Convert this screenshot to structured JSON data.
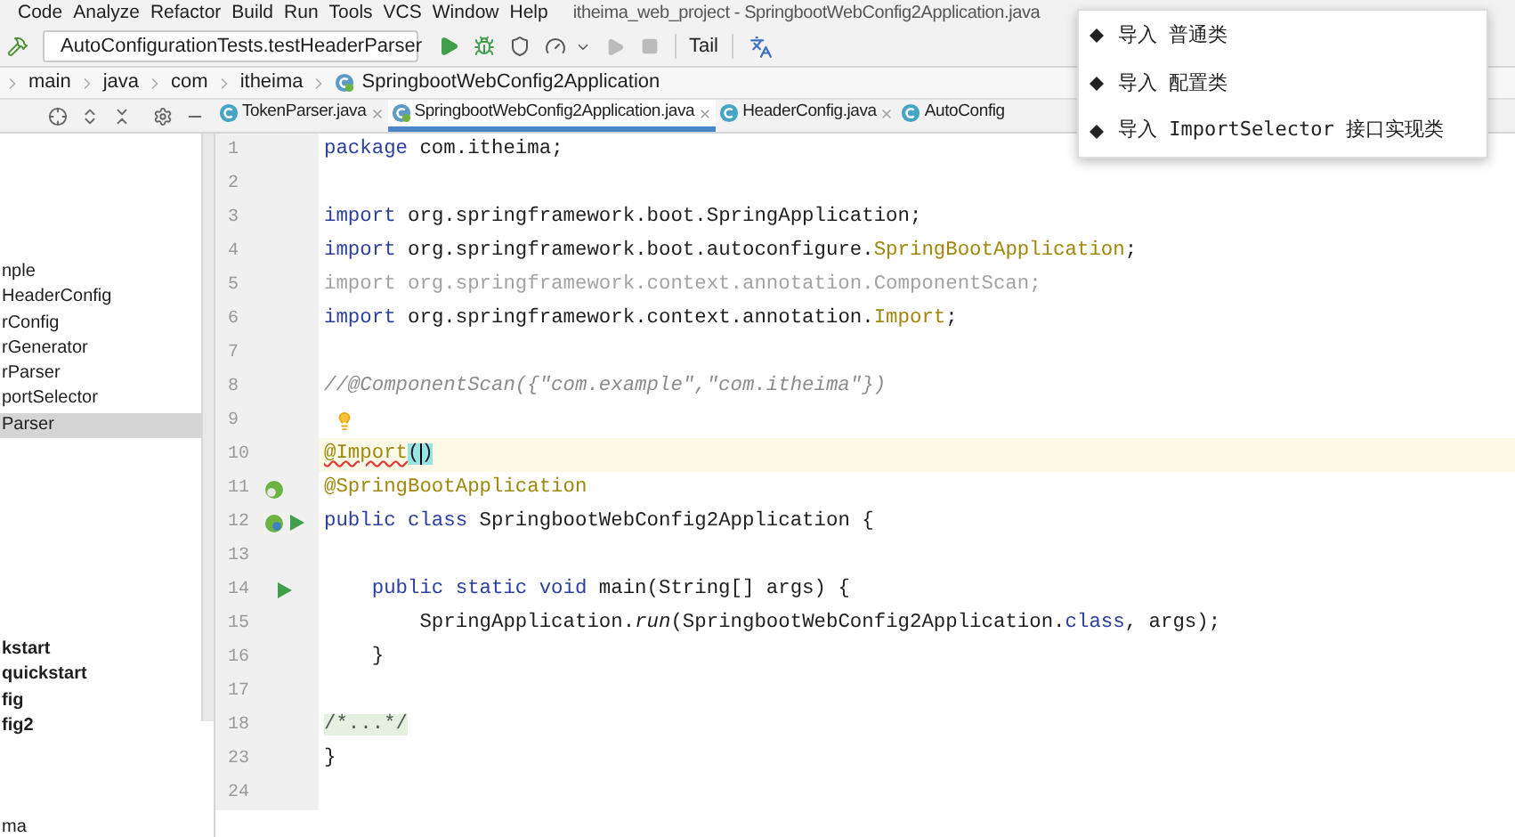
{
  "menu": [
    {
      "label": "Code"
    },
    {
      "label": "Analyze"
    },
    {
      "label": "Refactor"
    },
    {
      "label": "Build"
    },
    {
      "label": "Run"
    },
    {
      "label": "Tools"
    },
    {
      "label": "VCS"
    },
    {
      "label": "Window"
    },
    {
      "label": "Help"
    }
  ],
  "window_title": "itheima_web_project - SpringbootWebConfig2Application.java",
  "toolbar": {
    "run_config": "AutoConfigurationTests.testHeaderParser",
    "tail_label": "Tail"
  },
  "breadcrumbs": [
    "main",
    "java",
    "com",
    "itheima",
    "SpringbootWebConfig2Application"
  ],
  "tabs": [
    {
      "label": "TokenParser.java",
      "selected": false
    },
    {
      "label": "SpringbootWebConfig2Application.java",
      "selected": true
    },
    {
      "label": "HeaderConfig.java",
      "selected": false
    },
    {
      "label": "AutoConfig",
      "selected": false
    }
  ],
  "project_tree": {
    "groups": [
      {
        "items": [
          {
            "label": "nple",
            "bold": false,
            "selected": false
          },
          {
            "label": "HeaderConfig",
            "bold": false,
            "selected": false
          },
          {
            "label": "rConfig",
            "bold": false,
            "selected": false
          },
          {
            "label": "rGenerator",
            "bold": false,
            "selected": false
          },
          {
            "label": "rParser",
            "bold": false,
            "selected": false
          },
          {
            "label": "portSelector",
            "bold": false,
            "selected": false
          },
          {
            "label": "Parser",
            "bold": false,
            "selected": true
          }
        ]
      },
      {
        "items": [
          {
            "label": "kstart",
            "bold": true,
            "selected": false
          },
          {
            "label": "quickstart",
            "bold": true,
            "selected": false
          },
          {
            "label": "fig",
            "bold": true,
            "selected": false
          },
          {
            "label": "fig2",
            "bold": true,
            "selected": false
          }
        ]
      },
      {
        "items": [
          {
            "label": "ma",
            "bold": false,
            "selected": false
          }
        ]
      }
    ]
  },
  "editor": {
    "lines": [
      {
        "number": "1",
        "current": false,
        "tokens": [
          {
            "text": "package",
            "kind": "keyword"
          },
          {
            "text": " com.itheima;",
            "kind": "plain"
          }
        ]
      },
      {
        "number": "2",
        "current": false
      },
      {
        "number": "3",
        "current": false,
        "tokens": [
          {
            "text": "import",
            "kind": "keyword"
          },
          {
            "text": " org.springframework.boot.SpringApplication;",
            "kind": "plain"
          }
        ]
      },
      {
        "number": "4",
        "current": false,
        "tokens": [
          {
            "text": "import",
            "kind": "keyword"
          },
          {
            "text": " org.springframework.boot.autoconfigure.",
            "kind": "plain"
          },
          {
            "text": "SpringBootApplication",
            "kind": "annotation"
          },
          {
            "text": ";",
            "kind": "plain"
          }
        ]
      },
      {
        "number": "5",
        "current": false,
        "tokens": [
          {
            "text": "import org.springframework.context.annotation.ComponentScan;",
            "kind": "unused"
          }
        ]
      },
      {
        "number": "6",
        "current": false,
        "tokens": [
          {
            "text": "import",
            "kind": "keyword"
          },
          {
            "text": " org.springframework.context.annotation.",
            "kind": "plain"
          },
          {
            "text": "Import",
            "kind": "annotation"
          },
          {
            "text": ";",
            "kind": "plain"
          }
        ]
      },
      {
        "number": "7",
        "current": false
      },
      {
        "number": "8",
        "current": false,
        "tokens": [
          {
            "text": "//@ComponentScan({\"com.example\",\"com.itheima\"})",
            "kind": "comment"
          }
        ]
      },
      {
        "number": "9",
        "current": false
      },
      {
        "number": "10",
        "current": true,
        "tokens": [
          {
            "text": "@Import",
            "kind": "error-annotation"
          },
          {
            "text": "(",
            "kind": "brace"
          },
          {
            "text": ")",
            "kind": "brace-caret"
          }
        ]
      },
      {
        "number": "11",
        "current": false,
        "tokens": [
          {
            "text": "@SpringBootApplication",
            "kind": "annotation"
          }
        ]
      },
      {
        "number": "12",
        "current": false,
        "tokens": [
          {
            "text": "public class",
            "kind": "keyword"
          },
          {
            "text": " SpringbootWebConfig2Application {",
            "kind": "plain"
          }
        ]
      },
      {
        "number": "13",
        "current": false
      },
      {
        "number": "14",
        "current": false,
        "tokens": [
          {
            "text": "    public static void",
            "kind": "keyword"
          },
          {
            "text": " main(String[] args) {",
            "kind": "plain"
          }
        ]
      },
      {
        "number": "15",
        "current": false,
        "tokens": [
          {
            "text": "        SpringApplication.",
            "kind": "plain"
          },
          {
            "text": "run",
            "kind": "call"
          },
          {
            "text": "(SpringbootWebConfig2Application.",
            "kind": "plain"
          },
          {
            "text": "class",
            "kind": "keyword"
          },
          {
            "text": ", args);",
            "kind": "plain"
          }
        ]
      },
      {
        "number": "16",
        "current": false,
        "tokens": [
          {
            "text": "    }",
            "kind": "plain"
          }
        ]
      },
      {
        "number": "17",
        "current": false
      },
      {
        "number": "18",
        "current": false,
        "tokens": [
          {
            "text": "/*...*/",
            "kind": "folded"
          }
        ]
      },
      {
        "number": "23",
        "current": false,
        "tokens": [
          {
            "text": "}",
            "kind": "plain"
          }
        ]
      },
      {
        "number": "24",
        "current": false
      }
    ]
  },
  "popup": {
    "items": [
      {
        "label": "导入 普通类"
      },
      {
        "label": "导入 配置类"
      },
      {
        "label": "导入 ImportSelector 接口实现类"
      }
    ]
  }
}
